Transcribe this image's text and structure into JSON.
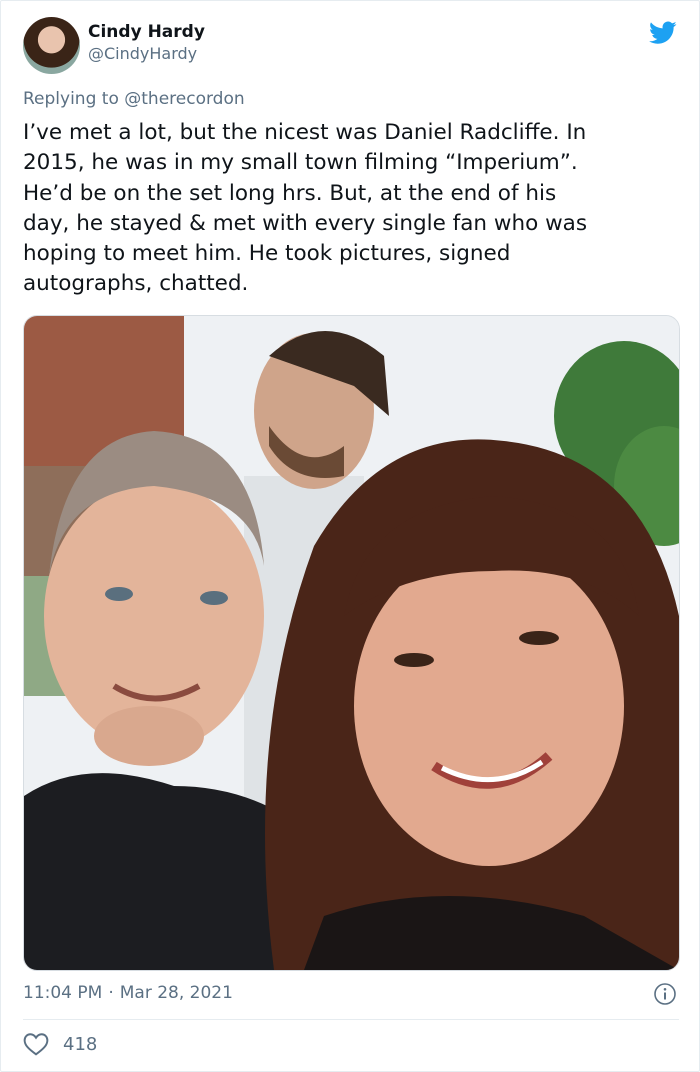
{
  "tweet": {
    "author": {
      "display_name": "Cindy Hardy",
      "handle": "@CindyHardy"
    },
    "reply": {
      "prefix": "Replying to",
      "mention": "@therecordon"
    },
    "text": "I’ve met a lot, but the nicest was Daniel Radcliffe. In\n2015, he was in my small town filming “Imperium”.\nHe’d be on the set long hrs. But, at the end of his\nday, he stayed & met with every single fan who was\nhoping to meet him. He took pictures, signed\nautographs, chatted.",
    "time": "11:04 PM",
    "separator": "·",
    "date": "Mar 28, 2021",
    "likes": "418"
  },
  "icons": {
    "brand": "twitter-bird-icon",
    "info": "info-icon",
    "like": "heart-icon"
  },
  "colors": {
    "brand": "#1da1f2",
    "secondary_text": "#5b7083",
    "primary_text": "#0f1419",
    "divider": "#e6ecf0"
  }
}
